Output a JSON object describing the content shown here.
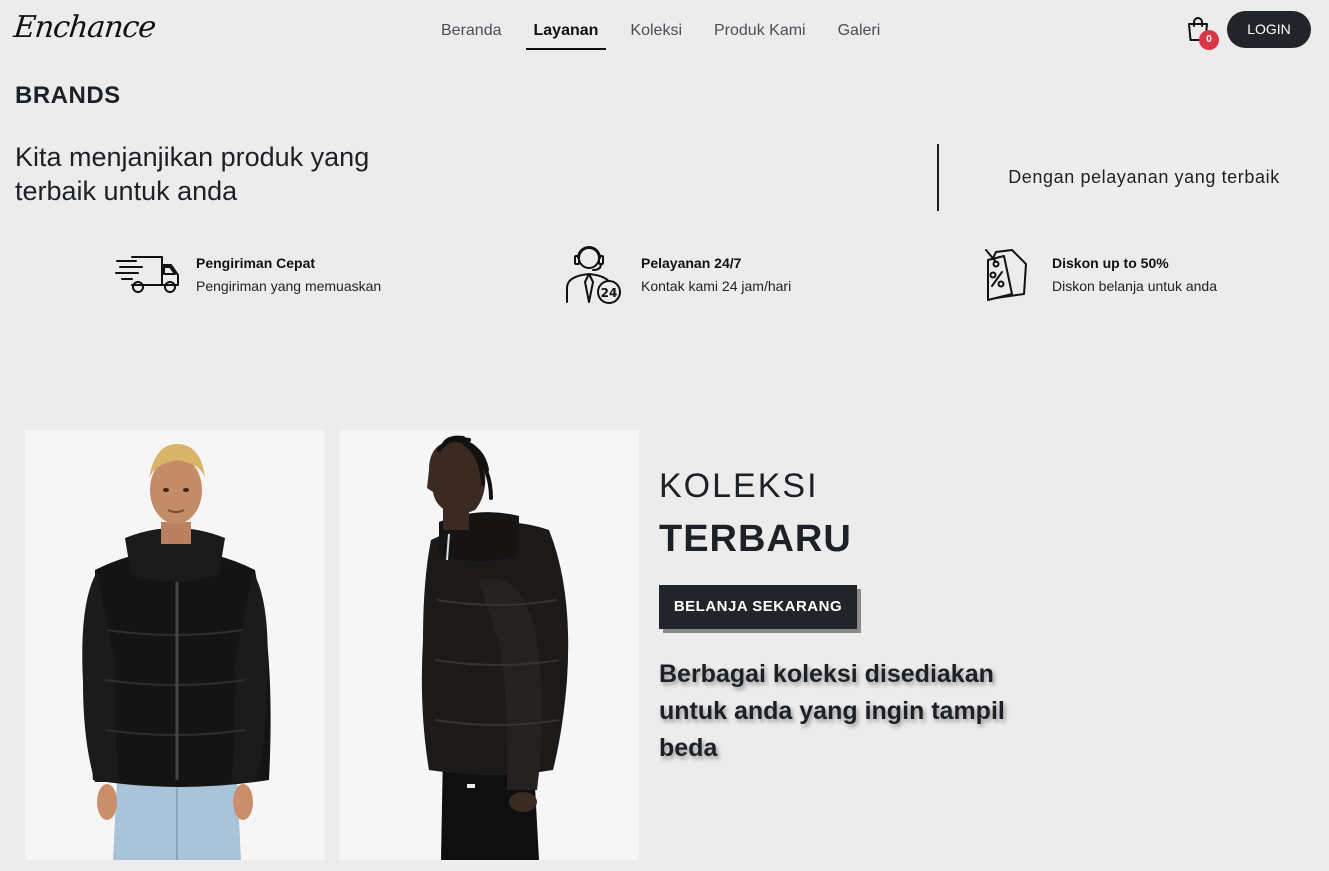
{
  "brand": {
    "logo": "Enchance"
  },
  "nav": {
    "items": [
      {
        "label": "Beranda"
      },
      {
        "label": "Layanan"
      },
      {
        "label": "Koleksi"
      },
      {
        "label": "Produk Kami"
      },
      {
        "label": "Galeri"
      }
    ],
    "active": "Layanan"
  },
  "cart": {
    "icon": "shopping-bag-icon",
    "count": "0"
  },
  "login": {
    "label": "LOGIN"
  },
  "brands": {
    "title": "BRANDS",
    "promise": "Kita menjanjikan produk yang terbaik untuk anda",
    "service_note": "Dengan pelayanan yang terbaik"
  },
  "features": [
    {
      "icon": "delivery-truck-icon",
      "title": "Pengiriman Cepat",
      "desc": "Pengiriman yang memuaskan"
    },
    {
      "icon": "customer-service-24-icon",
      "title": "Pelayanan 24/7",
      "desc": "Kontak kami 24 jam/hari"
    },
    {
      "icon": "discount-tag-icon",
      "title": "Diskon up to 50%",
      "desc": "Diskon belanja untuk anda"
    }
  ],
  "collection": {
    "heading_light": "KOLEKSI",
    "heading_bold": "TERBARU",
    "cta": "BELANJA SEKARANG",
    "tagline": "Berbagai koleksi disediakan untuk anda yang ingin tampil beda"
  },
  "colors": {
    "dark": "#212529",
    "badge": "#dc3545",
    "background": "#ececec"
  }
}
